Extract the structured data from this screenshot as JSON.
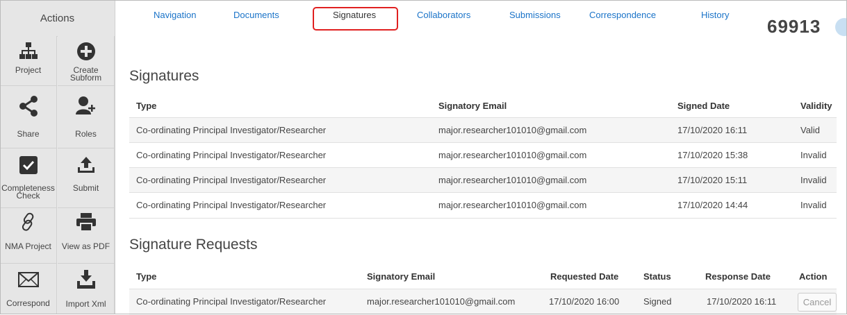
{
  "sidebar": {
    "title": "Actions",
    "tiles": [
      {
        "label": "Project",
        "icon": "sitemap-icon"
      },
      {
        "label": "Create\nSubform",
        "icon": "plus-circle-icon"
      },
      {
        "label": "Share",
        "icon": "share-icon"
      },
      {
        "label": "Roles",
        "icon": "user-plus-icon"
      },
      {
        "label": "Completeness\nCheck",
        "icon": "check-square-icon"
      },
      {
        "label": "Submit",
        "icon": "upload-icon"
      },
      {
        "label": "NMA Project",
        "icon": "link-icon"
      },
      {
        "label": "View as PDF",
        "icon": "print-icon"
      },
      {
        "label": "Correspond",
        "icon": "envelope-icon"
      },
      {
        "label": "Import Xml",
        "icon": "download-tray-icon"
      }
    ]
  },
  "tabs": [
    {
      "label": "Navigation"
    },
    {
      "label": "Documents"
    },
    {
      "label": "Signatures",
      "active": true
    },
    {
      "label": "Collaborators"
    },
    {
      "label": "Submissions"
    },
    {
      "label": "Correspondence"
    },
    {
      "label": "History"
    }
  ],
  "record_id": "69913",
  "signatures": {
    "title": "Signatures",
    "headers": {
      "type": "Type",
      "email": "Signatory Email",
      "date": "Signed Date",
      "validity": "Validity"
    },
    "rows": [
      {
        "type": "Co-ordinating Principal Investigator/Researcher",
        "email": "major.researcher101010@gmail.com",
        "date": "17/10/2020 16:11",
        "validity": "Valid"
      },
      {
        "type": "Co-ordinating Principal Investigator/Researcher",
        "email": "major.researcher101010@gmail.com",
        "date": "17/10/2020 15:38",
        "validity": "Invalid"
      },
      {
        "type": "Co-ordinating Principal Investigator/Researcher",
        "email": "major.researcher101010@gmail.com",
        "date": "17/10/2020 15:11",
        "validity": "Invalid"
      },
      {
        "type": "Co-ordinating Principal Investigator/Researcher",
        "email": "major.researcher101010@gmail.com",
        "date": "17/10/2020 14:44",
        "validity": "Invalid"
      }
    ]
  },
  "requests": {
    "title": "Signature Requests",
    "headers": {
      "type": "Type",
      "email": "Signatory Email",
      "requested": "Requested Date",
      "status": "Status",
      "response": "Response Date",
      "action": "Action"
    },
    "rows": [
      {
        "type": "Co-ordinating Principal Investigator/Researcher",
        "email": "major.researcher101010@gmail.com",
        "requested": "17/10/2020 16:00",
        "status": "Signed",
        "response": "17/10/2020 16:11",
        "action": "Cancel"
      }
    ]
  },
  "colors": {
    "link": "#1a73c8",
    "highlight": "#e02020",
    "sidebar_bg": "#e6e6e6"
  }
}
